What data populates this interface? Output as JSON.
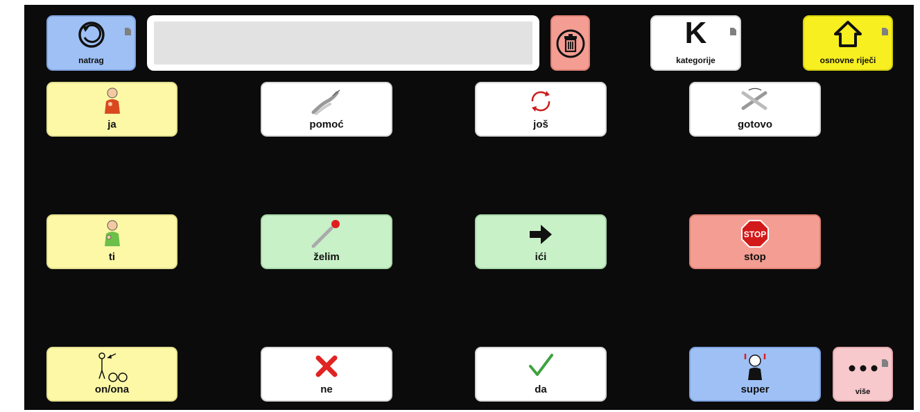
{
  "toolbar": {
    "back_label": "natrag",
    "categories_label": "kategorije",
    "categories_letter": "K",
    "core_words_label": "osnovne riječi",
    "message_text": ""
  },
  "grid": {
    "row1": [
      "ja",
      "pomoć",
      "još",
      "gotovo"
    ],
    "row2": [
      "ti",
      "želim",
      "ići",
      "stop"
    ],
    "row3": [
      "on/ona",
      "ne",
      "da",
      "super"
    ],
    "more_label": "više",
    "stop_sign_text": "STOP"
  },
  "colors": {
    "pronoun": "#fcf8a6",
    "verb": "#c8f1c8",
    "stop": "#f49d92",
    "social": "#9ec0f5",
    "home": "#f7ef1f",
    "more": "#f7c8cc",
    "neutral": "#ffffff",
    "background": "#0b0b0b"
  },
  "icons": {
    "back": "undo-circle-icon",
    "clear": "trash-icon",
    "home": "home-icon",
    "more": "dots-icon"
  }
}
